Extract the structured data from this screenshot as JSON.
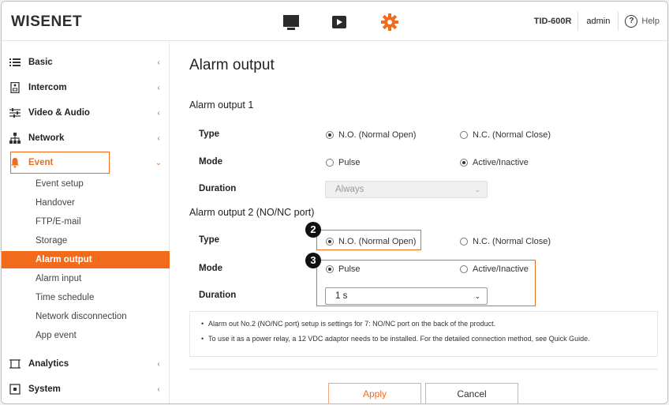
{
  "header": {
    "logo": "WISENET",
    "model": "TID-600R",
    "user": "admin",
    "help": "Help",
    "icons": [
      "monitor-icon",
      "play-icon",
      "gear-icon"
    ],
    "accent_color": "#f26b1d"
  },
  "sidebar": {
    "menu": [
      {
        "label": "Basic",
        "icon": "list-icon"
      },
      {
        "label": "Intercom",
        "icon": "intercom-icon"
      },
      {
        "label": "Video & Audio",
        "icon": "sliders-icon"
      },
      {
        "label": "Network",
        "icon": "network-icon"
      },
      {
        "label": "Event",
        "icon": "bell-icon"
      },
      {
        "label": "Analytics",
        "icon": "frame-icon"
      },
      {
        "label": "System",
        "icon": "system-icon"
      }
    ],
    "event_sub": [
      "Event setup",
      "Handover",
      "FTP/E-mail",
      "Storage",
      "Alarm output",
      "Alarm input",
      "Time schedule",
      "Network disconnection",
      "App event"
    ],
    "active_sub": "Alarm output"
  },
  "main": {
    "title": "Alarm output",
    "output1": {
      "title": "Alarm output 1",
      "type_label": "Type",
      "type_options": [
        "N.O. (Normal Open)",
        "N.C. (Normal Close)"
      ],
      "type_selected": "N.O. (Normal Open)",
      "mode_label": "Mode",
      "mode_options": [
        "Pulse",
        "Active/Inactive"
      ],
      "mode_selected": "Active/Inactive",
      "duration_label": "Duration",
      "duration_value": "Always"
    },
    "output2": {
      "title": "Alarm output 2 (NO/NC port)",
      "type_label": "Type",
      "type_options": [
        "N.O. (Normal Open)",
        "N.C. (Normal Close)"
      ],
      "type_selected": "N.O. (Normal Open)",
      "mode_label": "Mode",
      "mode_options": [
        "Pulse",
        "Active/Inactive"
      ],
      "mode_selected": "Pulse",
      "duration_label": "Duration",
      "duration_value": "1 s"
    },
    "badges": [
      "2",
      "3"
    ],
    "notes": [
      "Alarm out No.2 (NO/NC port) setup is settings for 7: NO/NC port on the back of the product.",
      "To use it as a power relay, a 12 VDC adaptor needs to be installed. For the detailed connection method, see Quick Guide."
    ],
    "apply": "Apply",
    "cancel": "Cancel"
  }
}
